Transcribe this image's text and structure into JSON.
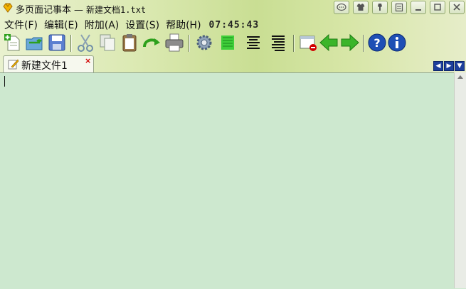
{
  "window": {
    "app_name": "多页面记事本",
    "separator": "—",
    "file_name": "新建文档1.txt",
    "buttons": [
      "comment-icon",
      "shirt-icon",
      "pin-icon",
      "note-icon",
      "minimize-icon",
      "maximize-icon",
      "close-icon"
    ]
  },
  "menu": {
    "items": [
      "文件(F)",
      "编辑(E)",
      "附加(A)",
      "设置(S)",
      "帮助(H)"
    ],
    "clock": "07:45:43"
  },
  "toolbar": {
    "icons": [
      "new-file-icon",
      "open-file-icon",
      "save-icon",
      "cut-icon",
      "copy-icon",
      "paste-icon",
      "redo-icon",
      "print-icon",
      "settings-gear-icon",
      "highlight-lines-icon",
      "align-center-icon",
      "align-justify-icon",
      "close-window-icon",
      "back-arrow-icon",
      "forward-arrow-icon",
      "help-icon",
      "info-icon"
    ]
  },
  "tabs": [
    {
      "label": "新建文件1",
      "close": "×"
    }
  ],
  "editor": {
    "content": ""
  },
  "colors": {
    "editor_bg": "#cde8cf",
    "accent_green": "#2da01c",
    "help_blue": "#1e4fb5",
    "close_red": "#d10000"
  }
}
